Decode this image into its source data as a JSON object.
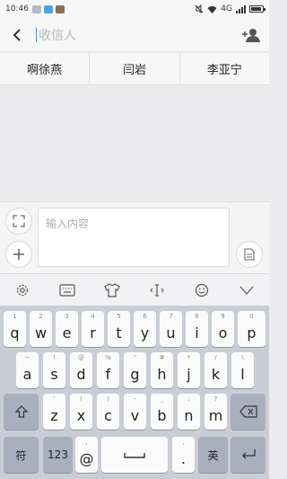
{
  "status_bar": {
    "time": "10:46",
    "network": "4G"
  },
  "header": {
    "recipient_placeholder": "收信人"
  },
  "suggestions": [
    "啊徐燕",
    "闫岩",
    "李亚宁"
  ],
  "composer": {
    "placeholder": "输入内容"
  },
  "keyboard": {
    "row1": [
      {
        "key": "q",
        "sub": "1"
      },
      {
        "key": "w",
        "sub": "2"
      },
      {
        "key": "e",
        "sub": "3"
      },
      {
        "key": "r",
        "sub": "4"
      },
      {
        "key": "t",
        "sub": "5"
      },
      {
        "key": "y",
        "sub": "6"
      },
      {
        "key": "u",
        "sub": "7"
      },
      {
        "key": "i",
        "sub": "8"
      },
      {
        "key": "o",
        "sub": "9"
      },
      {
        "key": "p",
        "sub": "0"
      }
    ],
    "row2": [
      {
        "key": "a",
        "sub": "~"
      },
      {
        "key": "s",
        "sub": "!"
      },
      {
        "key": "d",
        "sub": "@"
      },
      {
        "key": "f",
        "sub": "%"
      },
      {
        "key": "g",
        "sub": "\""
      },
      {
        "key": "h",
        "sub": "#"
      },
      {
        "key": "j",
        "sub": "*"
      },
      {
        "key": "k",
        "sub": "/"
      },
      {
        "key": "l",
        "sub": "\\"
      }
    ],
    "row3": [
      {
        "key": "z",
        "sub": "'"
      },
      {
        "key": "x",
        "sub": "("
      },
      {
        "key": "c",
        "sub": ")"
      },
      {
        "key": "v",
        "sub": "-"
      },
      {
        "key": "b",
        "sub": "_"
      },
      {
        "key": "n",
        "sub": ":"
      },
      {
        "key": "m",
        "sub": "?"
      }
    ],
    "symbols_label": "符",
    "numbers_label": "123",
    "at_label": "@",
    "at_sub": ",",
    "period_label": ".",
    "period_sub": ",",
    "lang_label": "英"
  }
}
